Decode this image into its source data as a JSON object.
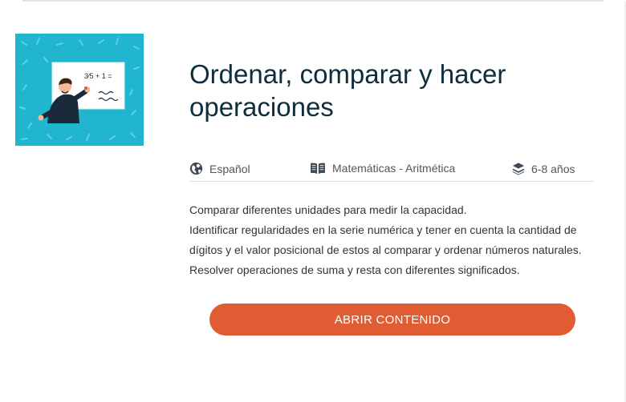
{
  "resource": {
    "title": "Ordenar, comparar y hacer operaciones",
    "thumbnail": {
      "alt": "teacher-at-whiteboard",
      "board_text": "3/5 + 1 =",
      "background_color": "#1fb6ce"
    },
    "meta": {
      "language": {
        "icon": "globe-icon",
        "label": "Español"
      },
      "subject": {
        "icon": "open-book-icon",
        "label": "Matemáticas - Aritmética"
      },
      "age": {
        "icon": "layers-icon",
        "label": "6-8 años"
      }
    },
    "description": [
      "Comparar diferentes unidades para medir la capacidad.",
      "Identificar regularidades en la serie numérica y tener en cuenta la cantidad de dígitos y el valor posicional de estos al comparar y ordenar números naturales.",
      "Resolver operaciones de suma y resta con diferentes significados."
    ],
    "open_button_label": "ABRIR CONTENIDO",
    "accent_color": "#e05d33"
  }
}
